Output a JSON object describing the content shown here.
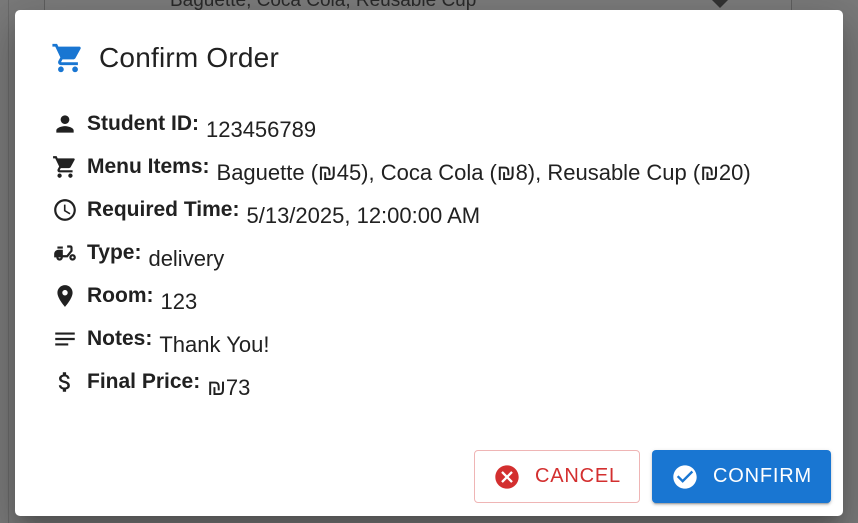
{
  "background": {
    "select_value": "Baguette, Coca Cola, Reusable Cup"
  },
  "dialog": {
    "title": "Confirm Order",
    "title_icon": "shopping-cart-icon",
    "rows": [
      {
        "label": "Student ID:",
        "value": "123456789",
        "icon": "person-icon"
      },
      {
        "label": "Menu Items:",
        "value": "Baguette (₪45), Coca Cola (₪8), Reusable Cup (₪20)",
        "icon": "shopping-cart-icon"
      },
      {
        "label": "Required Time:",
        "value": "5/13/2025, 12:00:00 AM",
        "icon": "clock-icon"
      },
      {
        "label": "Type:",
        "value": "delivery",
        "icon": "delivery-scooter-icon"
      },
      {
        "label": "Room:",
        "value": "123",
        "icon": "location-pin-icon"
      },
      {
        "label": "Notes:",
        "value": "Thank You!",
        "icon": "notes-icon"
      },
      {
        "label": "Final Price:",
        "value": "₪73",
        "icon": "dollar-icon"
      }
    ],
    "cancel_label": "CANCEL",
    "confirm_label": "CONFIRM"
  },
  "colors": {
    "primary": "#1976d2",
    "error": "#d32f2f",
    "text": "#212121",
    "overlay": "#7a7a7a"
  }
}
